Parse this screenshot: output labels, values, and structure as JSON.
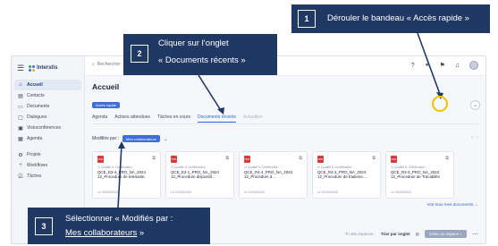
{
  "brand": {
    "name": "Interstis"
  },
  "sidebar": {
    "items": [
      {
        "label": "Accueil",
        "icon": "home-icon",
        "active": true
      },
      {
        "label": "Contacts",
        "icon": "contacts-icon"
      },
      {
        "label": "Documents",
        "icon": "documents-icon"
      },
      {
        "label": "Dialogues",
        "icon": "dialogues-icon"
      },
      {
        "label": "Visioconférences",
        "icon": "video-icon"
      },
      {
        "label": "Agenda",
        "icon": "calendar-icon"
      },
      {
        "label": "Projets",
        "icon": "projects-icon"
      },
      {
        "label": "Workflows",
        "icon": "workflows-icon"
      },
      {
        "label": "Tâches",
        "icon": "tasks-icon"
      }
    ]
  },
  "topbar": {
    "search_text": "Rechercher"
  },
  "main": {
    "title": "Accueil",
    "quick_access_label": "Accès rapide",
    "tabs": [
      {
        "label": "Agenda"
      },
      {
        "label": "Actions attendues"
      },
      {
        "label": "Tâches en cours"
      },
      {
        "label": "Documents récents",
        "active": true
      },
      {
        "label": "Actualités",
        "muted": true
      }
    ],
    "filter_label": "Modifiés par :",
    "filter_value": "Mes collaborateurs",
    "cards": [
      {
        "category": "O Qualité & Certification",
        "title": "QCE_E3-4_PRO_NA_2024 12_Procedure de telesante",
        "date": "Le 02/05/2025"
      },
      {
        "category": "O Qualité & Certification",
        "title": "QCE_E3-1_PRO_NA_2024 12_Procedure dispositif...",
        "date": "Le 02/05/2025"
      },
      {
        "category": "O Qualité & Certification",
        "title": "QCE_R4-4_PRO_NA_2024 12_Procedure d...",
        "date": "Le 02/05/2025"
      },
      {
        "category": "O Qualité & Certification",
        "title": "QCE_R4-3_PRO_NA_2024 12_Procedure de traiteme...",
        "date": "Le 02/05/2025"
      },
      {
        "category": "O Qualité & Certification",
        "title": "QCE_R3-3_PRO_NA_2024 12_Procedure de Tracabilite",
        "date": "Le 02/05/2025"
      }
    ],
    "see_all": "Voir tous mes documents →",
    "spaces_label": "Tri des espaces :",
    "sort_value": "Trier par onglet",
    "create_button": "Créer un espace +"
  },
  "callouts": [
    {
      "number": "1",
      "text": "Dérouler le bandeau « Accès rapide »"
    },
    {
      "number": "2",
      "line1": "Cliquer  sur l’onglet",
      "line2": "« Documents récents »"
    },
    {
      "number": "3",
      "line1": "Sélectionner « Modifiés par :",
      "line2_ul": "Mes collaborateurs",
      "line2_end": " »"
    }
  ],
  "colors": {
    "callout_bg": "#1f3864",
    "highlight": "#f2c200",
    "accent": "#3f6fd6"
  }
}
